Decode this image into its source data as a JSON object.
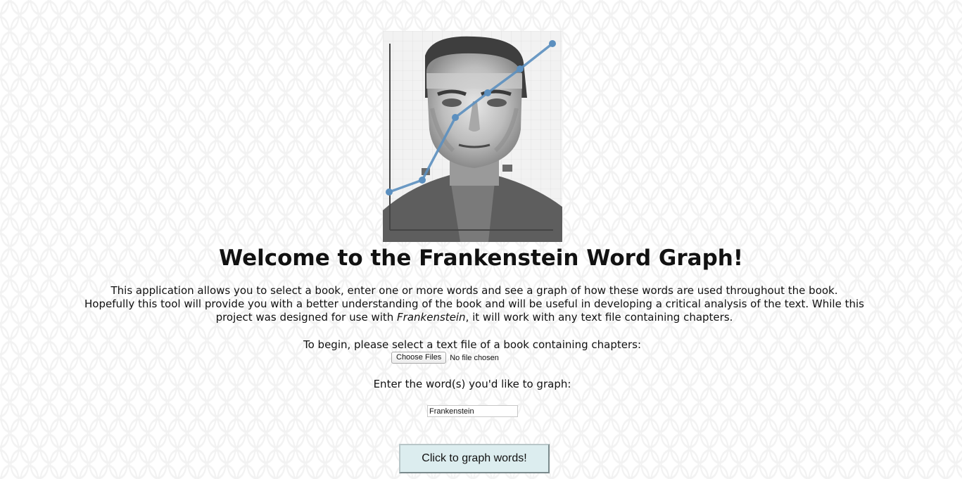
{
  "header": {
    "image_label": "Frankenstein with line graph overlay",
    "title": "Welcome to the Frankenstein Word Graph!"
  },
  "intro": {
    "text_before": "This application allows you to select a book, enter one or more words and see a graph of how these words are used throughout the book. Hopefully this tool will provide you with a better understanding of the book and will be useful in developing a critical analysis of the text. While this project was designed for use with ",
    "emphasis": "Frankenstein",
    "text_after": ", it will work with any text file containing chapters."
  },
  "file_picker": {
    "prompt": "To begin, please select a text file of a book containing chapters:",
    "button_label": "Choose Files",
    "status": "No file chosen"
  },
  "words": {
    "prompt": "Enter the word(s) you'd like to graph:",
    "value": "Frankenstein"
  },
  "submit": {
    "label": "Click to graph words!"
  },
  "colors": {
    "button_bg": "#dcedef",
    "graph_line": "#5b8fbf"
  }
}
